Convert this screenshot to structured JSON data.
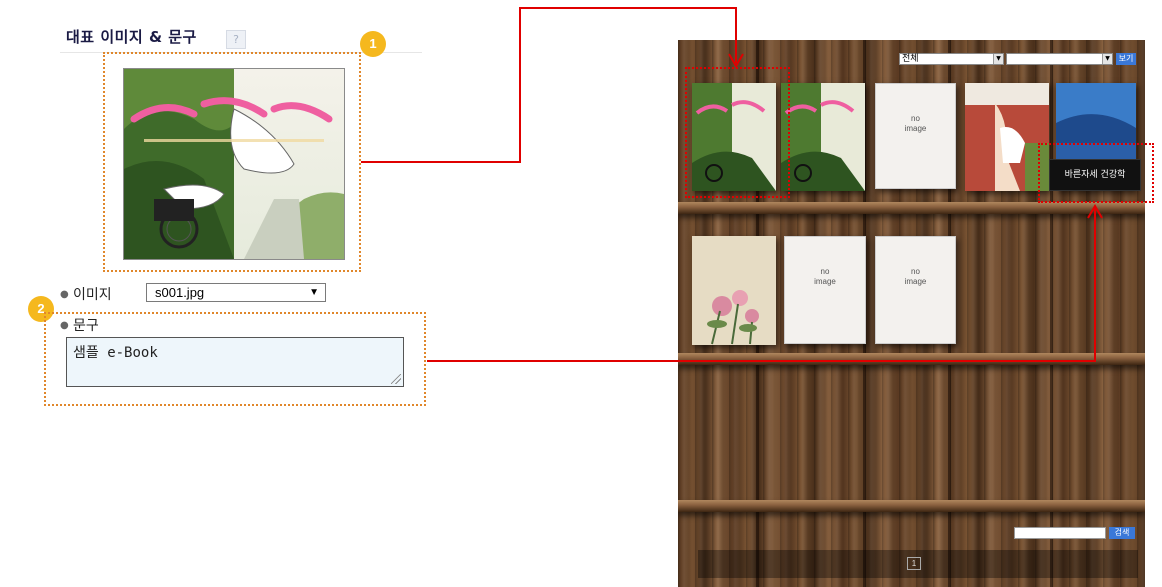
{
  "editor": {
    "section_title": "대표 이미지 & 문구",
    "help_label": "?",
    "badge_1": "1",
    "badge_2": "2",
    "image_field_label": "이미지",
    "image_select_value": "s001.jpg",
    "caption_field_label": "문구",
    "caption_textarea_value": "샘플 e-Book"
  },
  "viewer": {
    "category_select_value": "전체",
    "subcategory_select_value": "",
    "view_button_label": "보기",
    "search_input_value": "",
    "search_button_label": "검색",
    "current_page": "1",
    "caption_overlay_text": "바른자세 건강학",
    "no_image_label_line1": "no",
    "no_image_label_line2": "image"
  },
  "colors": {
    "badge": "#f5b81e",
    "dotted_highlight": "#e0872b",
    "arrow": "#e00000",
    "viewer_button": "#3a78d8"
  }
}
